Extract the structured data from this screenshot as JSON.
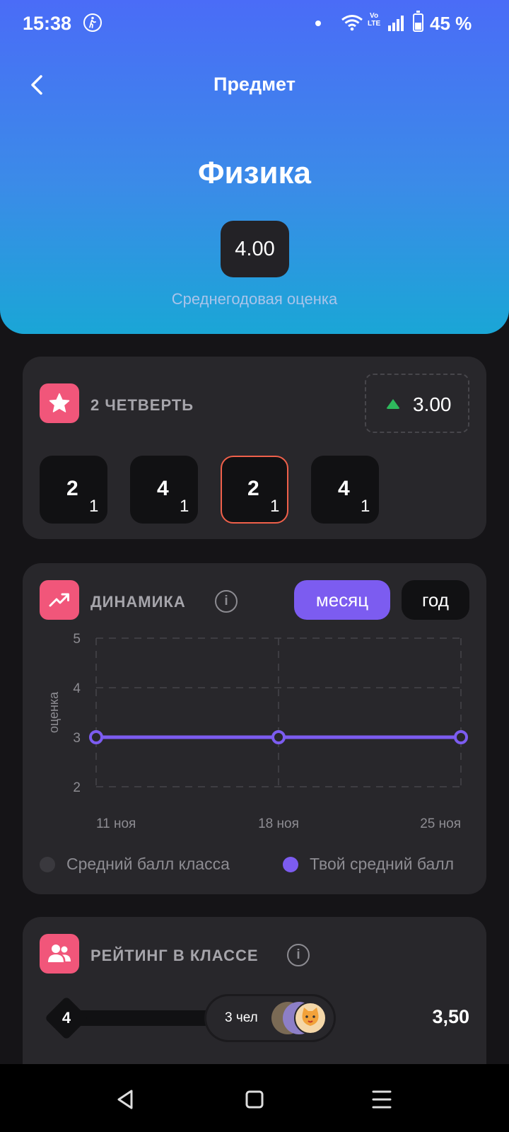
{
  "status_bar": {
    "time": "15:38",
    "network": "Vo\nLTE",
    "battery": "45 %",
    "icons": [
      "walk-icon",
      "notification-dot-icon",
      "wifi-icon",
      "volte-icon",
      "signal-icon",
      "battery-icon"
    ]
  },
  "header": {
    "title": "Предмет",
    "back_icon": "chevron-left-icon"
  },
  "subject": {
    "name": "Физика",
    "annual_grade": "4.00",
    "annual_caption": "Среднегодовая оценка"
  },
  "quarter": {
    "title": "2 ЧЕТВЕРТЬ",
    "icon": "star-icon",
    "average": "3.00",
    "trend": "up",
    "trend_color": "#2eb85c",
    "grades": [
      {
        "value": "2",
        "weight": "1",
        "selected": false
      },
      {
        "value": "4",
        "weight": "1",
        "selected": false
      },
      {
        "value": "2",
        "weight": "1",
        "selected": true
      },
      {
        "value": "4",
        "weight": "1",
        "selected": false
      }
    ]
  },
  "dynamics": {
    "title": "ДИНАМИКА",
    "icon": "trend-up-icon",
    "info_icon": "info-icon",
    "period_tabs": [
      {
        "label": "месяц",
        "active": true
      },
      {
        "label": "год",
        "active": false
      }
    ],
    "legend": [
      {
        "label": "Средний балл класса",
        "color": "#3a393e"
      },
      {
        "label": "Твой средний балл",
        "color": "#7c5cf0"
      }
    ]
  },
  "chart_data": {
    "type": "line",
    "ylabel": "оценка",
    "xlabel": "",
    "ylim": [
      2,
      5
    ],
    "yticks": [
      "5",
      "4",
      "3",
      "2"
    ],
    "x": [
      "11 ноя",
      "18 ноя",
      "25 ноя"
    ],
    "series": [
      {
        "name": "Твой средний балл",
        "values": [
          3,
          3,
          3
        ],
        "color": "#7c5cf0"
      }
    ],
    "grid": true
  },
  "rating": {
    "title": "РЕЙТИНГ В КЛАССЕ",
    "icon": "users-icon",
    "info_icon": "info-icon",
    "position": "4",
    "people_count": "3 чел",
    "score": "3,50"
  },
  "nav_bar": {
    "buttons": [
      "back-triangle-icon",
      "home-square-icon",
      "recents-menu-icon"
    ]
  }
}
